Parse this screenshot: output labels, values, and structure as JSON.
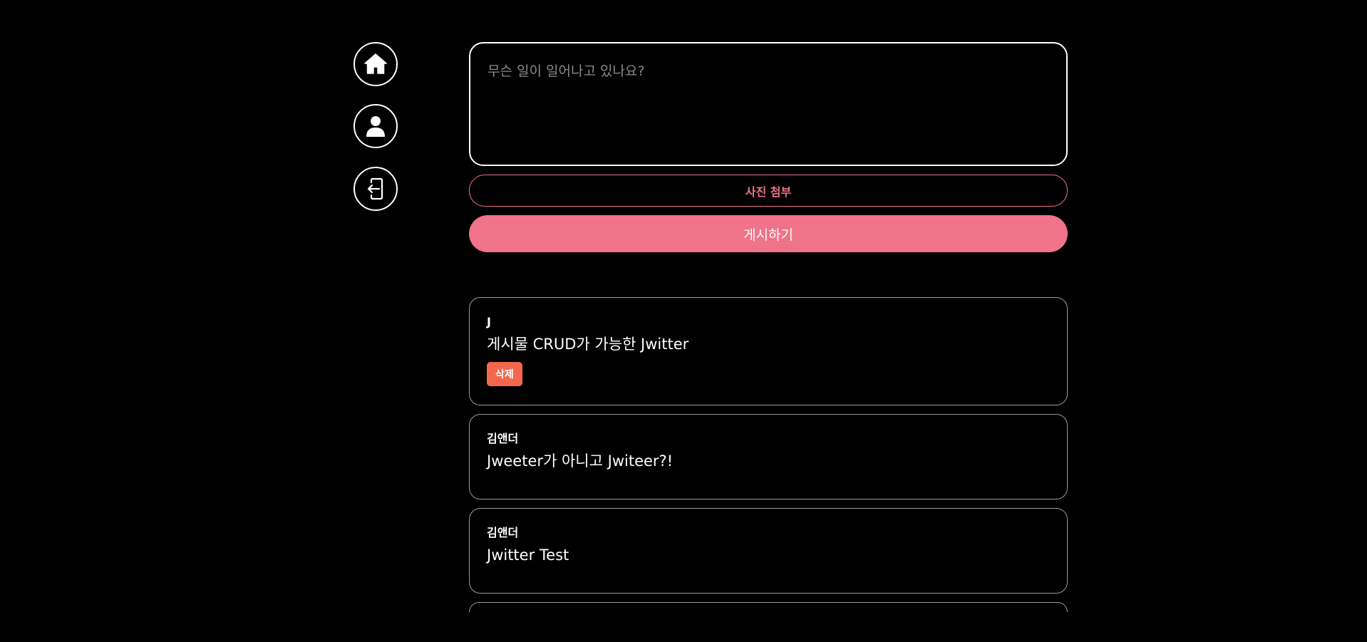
{
  "sidebar": {
    "items": [
      {
        "icon": "home-icon"
      },
      {
        "icon": "user-icon"
      },
      {
        "icon": "logout-icon"
      }
    ]
  },
  "compose": {
    "placeholder": "무슨 일이 일어나고 있나요?",
    "value": ""
  },
  "actions": {
    "attach_label": "사진 첨부",
    "post_label": "게시하기"
  },
  "feed": {
    "tweets": [
      {
        "author": "J",
        "text": "게시물 CRUD가 가능한 Jwitter",
        "delete_label": "삭제"
      },
      {
        "author": "김앤더",
        "text": "Jweeter가 아니고 Jwiteer?!"
      },
      {
        "author": "김앤더",
        "text": "Jwitter Test"
      }
    ]
  },
  "colors": {
    "background": "#000000",
    "accent": "#f07489",
    "delete": "#f3684c",
    "border": "#ffffff"
  }
}
